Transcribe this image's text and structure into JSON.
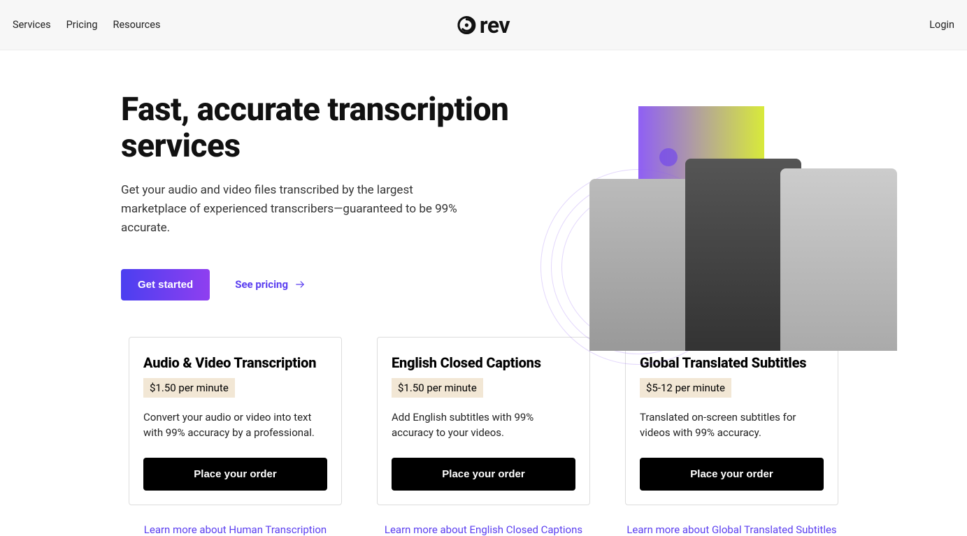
{
  "nav": {
    "services": "Services",
    "pricing": "Pricing",
    "resources": "Resources",
    "login": "Login",
    "brand": "rev"
  },
  "hero": {
    "title": "Fast, accurate transcription services",
    "subtitle": "Get your audio and video files transcribed by the largest marketplace of experienced transcribers—guaranteed to be 99% accurate.",
    "cta_primary": "Get started",
    "cta_secondary": "See pricing"
  },
  "cards": [
    {
      "title": "Audio & Video Transcription",
      "price": "$1.50 per minute",
      "desc": "Convert your audio or video into text with 99% accuracy by a professional.",
      "button": "Place your order",
      "learn": "Learn more about Human Transcription"
    },
    {
      "title": "English Closed Captions",
      "price": "$1.50 per minute",
      "desc": "Add English subtitles with 99% accuracy to your videos.",
      "button": "Place your order",
      "learn": "Learn more about English Closed Captions"
    },
    {
      "title": "Global Translated Subtitles",
      "price": "$5-12 per minute",
      "desc": "Translated on-screen subtitles for videos with 99% accuracy.",
      "button": "Place your order",
      "learn": "Learn more about Global Translated Subtitles"
    }
  ]
}
